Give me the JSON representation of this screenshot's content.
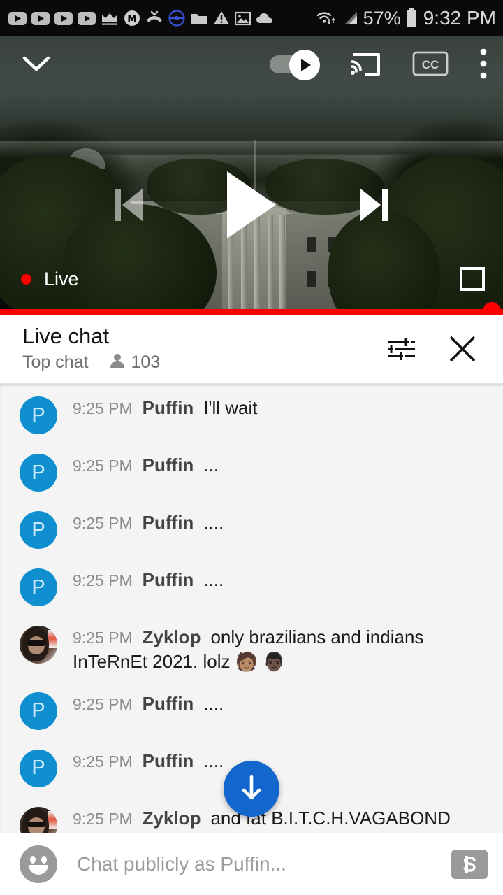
{
  "statusbar": {
    "icons_left": [
      "youtube-icon",
      "youtube-icon",
      "youtube-icon",
      "youtube-icon",
      "crown-icon",
      "m-circle-icon",
      "missed-call-icon",
      "pokeball-icon",
      "folder-icon",
      "warning-triangle-icon",
      "image-icon",
      "cloud-icon"
    ],
    "wifi_icon": "wifi-icon",
    "signal_icon": "cell-signal-icon",
    "battery_percent": "57%",
    "battery_icon": "battery-icon",
    "time": "9:32 PM"
  },
  "player": {
    "collapse_icon": "chevron-down-icon",
    "autoplay": {
      "name": "autoplay-toggle",
      "state": "on",
      "knob_icon": "play-icon"
    },
    "cast_icon": "cast-icon",
    "cc_label": "CC",
    "overflow_icon": "more-vertical-icon",
    "previous_icon": "skip-previous-icon",
    "play_icon": "play-icon",
    "next_icon": "skip-next-icon",
    "live_label": "Live",
    "fullscreen_icon": "fullscreen-icon",
    "progress_percent": 100,
    "accent_color": "#ff0000"
  },
  "chat_header": {
    "title": "Live chat",
    "subtitle": "Top chat",
    "viewer_icon": "person-icon",
    "viewer_count": "103",
    "settings_icon": "tune-icon",
    "close_icon": "close-icon"
  },
  "chat": {
    "scroll_down_icon": "arrow-down-icon",
    "messages": [
      {
        "avatar_type": "letter",
        "avatar_letter": "P",
        "time": "9:25 PM",
        "author": "Puffin",
        "text": "I'll wait"
      },
      {
        "avatar_type": "letter",
        "avatar_letter": "P",
        "time": "9:25 PM",
        "author": "Puffin",
        "text": "..."
      },
      {
        "avatar_type": "letter",
        "avatar_letter": "P",
        "time": "9:25 PM",
        "author": "Puffin",
        "text": "...."
      },
      {
        "avatar_type": "letter",
        "avatar_letter": "P",
        "time": "9:25 PM",
        "author": "Puffin",
        "text": "...."
      },
      {
        "avatar_type": "photo",
        "avatar_letter": "",
        "time": "9:25 PM",
        "author": "Zyklop",
        "text": "only brazilians and indians InTeRnEt 2021. lolz 🧑🏽 👨🏿"
      },
      {
        "avatar_type": "letter",
        "avatar_letter": "P",
        "time": "9:25 PM",
        "author": "Puffin",
        "text": "...."
      },
      {
        "avatar_type": "letter",
        "avatar_letter": "P",
        "time": "9:25 PM",
        "author": "Puffin",
        "text": "...."
      },
      {
        "avatar_type": "photo",
        "avatar_letter": "",
        "time": "9:25 PM",
        "author": "Zyklop",
        "text": "and fat B.I.T.C.H.VAGABOND"
      }
    ]
  },
  "chat_input": {
    "emoji_icon": "emoji-smiley-icon",
    "placeholder": "Chat publicly as Puffin...",
    "superchat_icon": "dollar-icon"
  }
}
